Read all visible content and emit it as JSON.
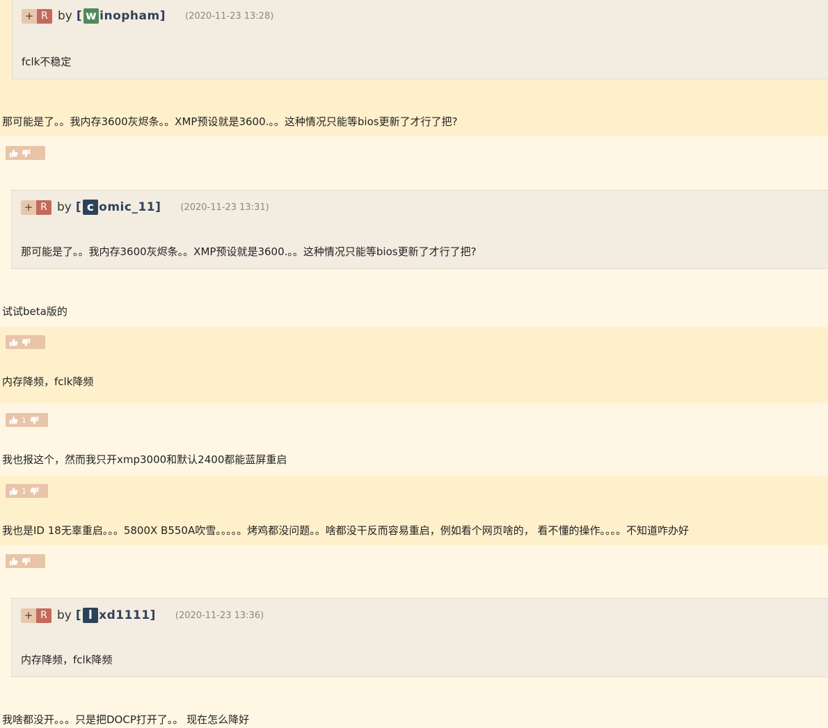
{
  "colors": {
    "band_dark": "#fff0cc",
    "band_light": "#fff7e4",
    "quote_bg": "#f3ece0",
    "r_button": "#c46a5d",
    "plus_button": "#e6c8ae",
    "vote_bg": "#e8c4a8",
    "avatar_green": "#4f8a5a",
    "avatar_navy": "#2c4258"
  },
  "quote1": {
    "plus": "+",
    "r": "R",
    "by": "by",
    "open": "[",
    "initial": "w",
    "rest": "inopham",
    "close": "]",
    "time": "(2020-11-23 13:28)",
    "text": "fclk不稳定"
  },
  "post1": {
    "text": "那可能是了。。我内存3600灰烬条。。XMP预设就是3600.。。这种情况只能等bios更新了才行了把?"
  },
  "quote2": {
    "plus": "+",
    "r": "R",
    "by": "by",
    "open": "[",
    "initial": "c",
    "rest": "omic_11",
    "close": "]",
    "time": "(2020-11-23 13:31)",
    "text": "那可能是了。。我内存3600灰烬条。。XMP预设就是3600.。。这种情况只能等bios更新了才行了把?"
  },
  "post2": {
    "text": "试试beta版的"
  },
  "post3": {
    "text": "内存降频，fclk降频"
  },
  "votes3": {
    "count": "1"
  },
  "post4": {
    "text": "我也报这个，然而我只开xmp3000和默认2400都能蓝屏重启"
  },
  "votes4": {
    "count": "1"
  },
  "post5": {
    "text": "我也是ID 18无辜重启。。。5800X B550A吹雪。。。。。烤鸡都没问题。。啥都没干反而容易重启，例如看个网页啥的， 看不懂的操作。。。。不知道咋办好"
  },
  "quote3": {
    "plus": "+",
    "r": "R",
    "by": "by",
    "open": "[",
    "initial": "l",
    "rest": "xd1111",
    "close": "]",
    "time": "(2020-11-23 13:36)",
    "text": "内存降频，fclk降频"
  },
  "post6": {
    "text": "我啥都没开。。。只是把DOCP打开了。。 现在怎么降好"
  }
}
